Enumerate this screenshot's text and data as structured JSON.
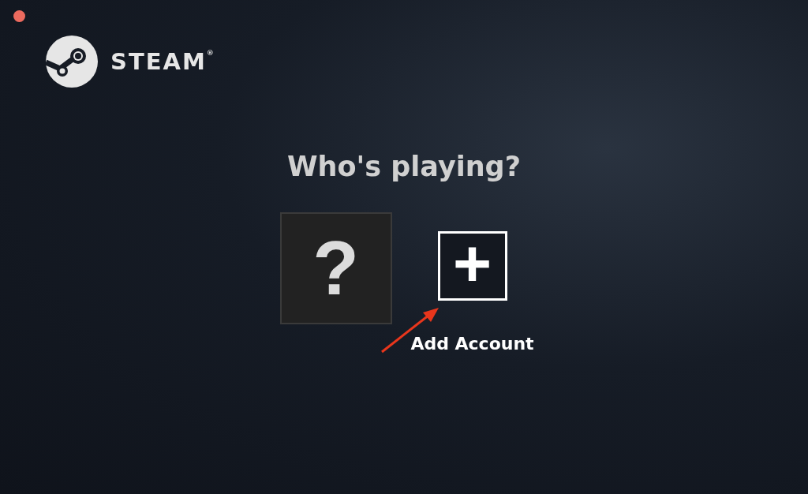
{
  "logo": {
    "wordmark": "STEAM$^{®}$"
  },
  "heading": "Who's playing?",
  "accounts": [
    {
      "kind": "unknown",
      "glyph": "?"
    },
    {
      "kind": "add",
      "glyph": "+",
      "label": "Add Account"
    }
  ]
}
